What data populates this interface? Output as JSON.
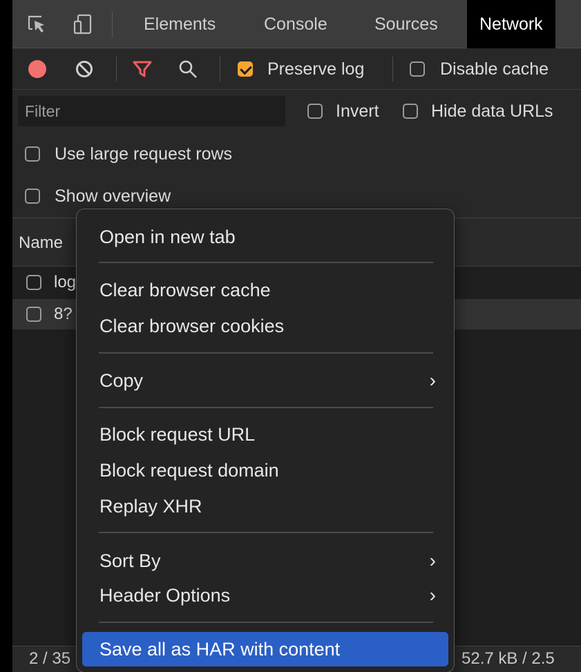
{
  "tabs": {
    "elements": "Elements",
    "console": "Console",
    "sources": "Sources",
    "network": "Network"
  },
  "toolbar": {
    "preserve_log": "Preserve log",
    "preserve_log_checked": true,
    "disable_cache": "Disable cache",
    "disable_cache_checked": false
  },
  "filter": {
    "placeholder": "Filter",
    "invert": "Invert",
    "hide_data_urls": "Hide data URLs"
  },
  "options": {
    "large_rows": "Use large request rows",
    "show_overview": "Show overview"
  },
  "table": {
    "name_header": "Name",
    "rows": [
      {
        "name": "log"
      },
      {
        "name": "8?"
      }
    ]
  },
  "status": {
    "requests": "2 / 35",
    "transferred": "52.7 kB / 2.5"
  },
  "menu": {
    "open_new_tab": "Open in new tab",
    "clear_cache": "Clear browser cache",
    "clear_cookies": "Clear browser cookies",
    "copy": "Copy",
    "block_url": "Block request URL",
    "block_domain": "Block request domain",
    "replay_xhr": "Replay XHR",
    "sort_by": "Sort By",
    "header_options": "Header Options",
    "save_har": "Save all as HAR with content"
  },
  "colors": {
    "accent_orange": "#f7a531",
    "record_red": "#f2706f",
    "filter_red": "#f05d5d",
    "menu_highlight": "#2a5fc6"
  },
  "icons": [
    "inspect-icon",
    "device-toolbar-icon",
    "record-icon",
    "clear-icon",
    "filter-icon",
    "search-icon",
    "chevron-right-icon"
  ]
}
